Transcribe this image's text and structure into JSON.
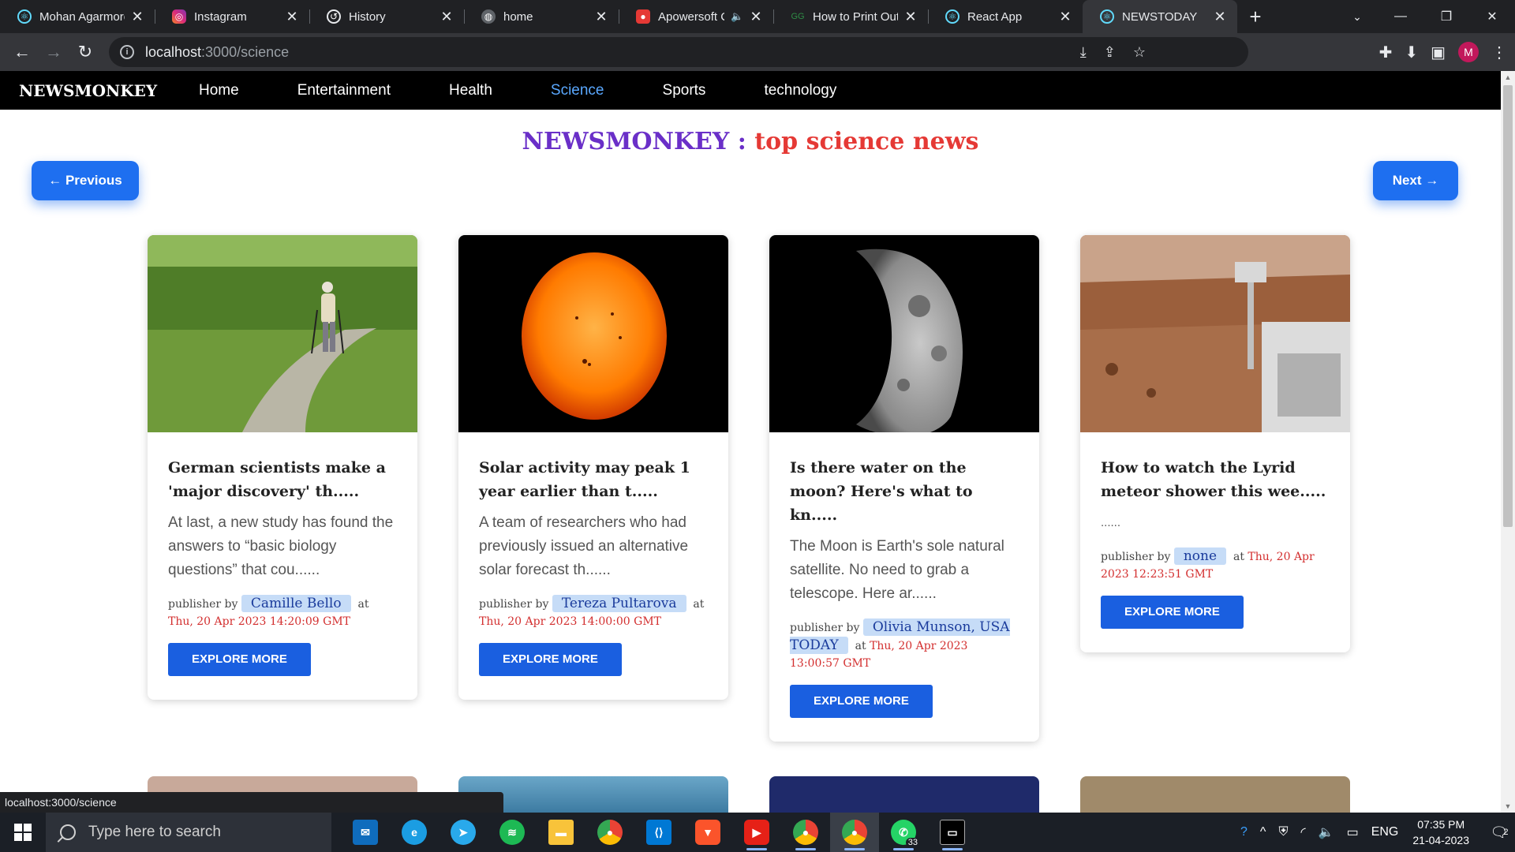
{
  "browser": {
    "tabs": [
      {
        "title": "Mohan Agarmore",
        "icon": "react-icon",
        "color": "#61dafb"
      },
      {
        "title": "Instagram",
        "icon": "instagram-icon",
        "color": "#e1306c"
      },
      {
        "title": "History",
        "icon": "history-icon",
        "color": "#e8eaed"
      },
      {
        "title": "home",
        "icon": "globe-icon",
        "color": "#e8eaed"
      },
      {
        "title": "Apowersoft C",
        "icon": "apowersoft-icon",
        "color": "#e53935"
      },
      {
        "title": "How to Print Out",
        "icon": "gfg-icon",
        "color": "#2f8d46"
      },
      {
        "title": "React App",
        "icon": "react-icon",
        "color": "#61dafb"
      },
      {
        "title": "NEWSTODAY",
        "icon": "react-icon",
        "color": "#61dafb"
      }
    ],
    "url_host": "localhost",
    "url_path": ":3000/science",
    "status_url": "localhost:3000/science"
  },
  "app": {
    "brand": "NEWSMONKEY",
    "nav": [
      "Home",
      "Entertainment",
      "Health",
      "Science",
      "Sports",
      "technology"
    ],
    "active_nav": "Science",
    "headline_brand": "NEWSMONKEY :",
    "headline_rest": " top science news",
    "prev_label": "← Previous",
    "next_label": "Next →",
    "publisher_prefix": "publisher by",
    "at_label": "at",
    "explore_label": "EXPLORE MORE",
    "cards": [
      {
        "title": "German scientists make a 'major discovery' th.....",
        "desc": "At last, a new study has found the answers to “basic biology questions” that cou......",
        "publisher": "Camille Bello",
        "time": "Thu, 20 Apr 2023 14:20:09 GMT",
        "image": "walking-man-photo"
      },
      {
        "title": "Solar activity may peak 1 year earlier than t.....",
        "desc": "A team of researchers who had previously issued an alternative solar forecast th......",
        "publisher": "Tereza Pultarova",
        "time": "Thu, 20 Apr 2023 14:00:00 GMT",
        "image": "sun-photo"
      },
      {
        "title": "Is there water on the moon? Here's what to kn.....",
        "desc": "The Moon is Earth's sole natural satellite. No need to grab a telescope. Here ar......",
        "publisher": "Olivia Munson, USA TODAY",
        "time": "Thu, 20 Apr 2023 13:00:57 GMT",
        "image": "moon-photo"
      },
      {
        "title": "How to watch the Lyrid meteor shower this wee.....",
        "desc": "......",
        "publisher": "none",
        "time": "Thu, 20 Apr 2023 12:23:51 GMT",
        "image": "mars-rover-photo"
      }
    ]
  },
  "taskbar": {
    "search_placeholder": "Type here to search",
    "language": "ENG",
    "time": "07:35 PM",
    "date": "21-04-2023",
    "whatsapp_badge": "33",
    "notification_count": "2"
  }
}
